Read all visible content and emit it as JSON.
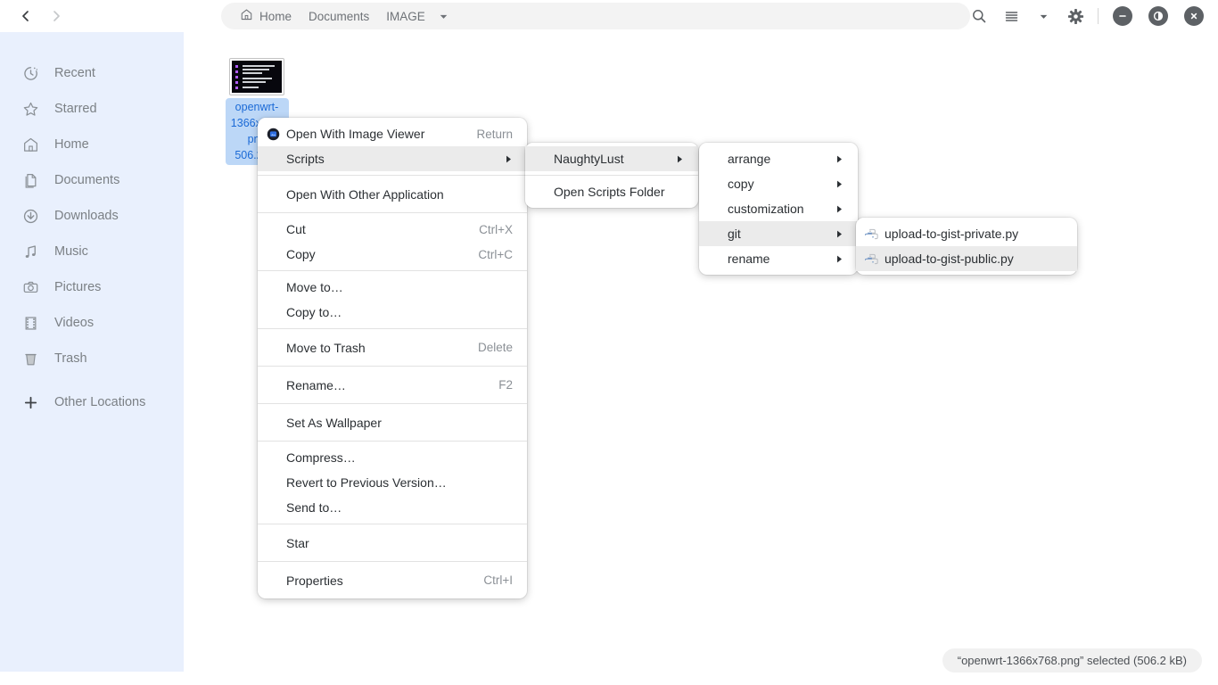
{
  "header": {
    "nav": {
      "back": "back-arrow",
      "forward": "forward-arrow"
    },
    "breadcrumbs": [
      {
        "label": "Home",
        "icon": "home-icon"
      },
      {
        "label": "Documents",
        "icon": ""
      },
      {
        "label": "IMAGE",
        "icon": ""
      }
    ],
    "actions": [
      {
        "name": "search-icon",
        "label": "Search"
      },
      {
        "name": "list-view-icon",
        "label": "View options"
      },
      {
        "name": "chevron-down-icon",
        "label": "View menu"
      },
      {
        "name": "gear-icon",
        "label": "Preferences"
      }
    ],
    "window_controls": [
      {
        "name": "minimize-button",
        "glyph": "minus"
      },
      {
        "name": "maximize-button",
        "glyph": "half-circle"
      },
      {
        "name": "close-button",
        "glyph": "cross"
      }
    ]
  },
  "sidebar": {
    "items": [
      {
        "label": "Recent",
        "icon": "clock-icon"
      },
      {
        "label": "Starred",
        "icon": "star-icon"
      },
      {
        "label": "Home",
        "icon": "home-icon"
      },
      {
        "label": "Documents",
        "icon": "documents-icon"
      },
      {
        "label": "Downloads",
        "icon": "download-icon"
      },
      {
        "label": "Music",
        "icon": "music-note-icon"
      },
      {
        "label": "Pictures",
        "icon": "camera-icon"
      },
      {
        "label": "Videos",
        "icon": "film-icon"
      },
      {
        "label": "Trash",
        "icon": "trash-icon"
      }
    ],
    "other_locations": {
      "label": "Other Locations",
      "icon": "plus-icon"
    }
  },
  "files": [
    {
      "name": "openwrt-1366x768.png",
      "size": "506.2 kB",
      "label_line1": "openwrt-",
      "label_line2": "1366x768.",
      "label_line3": "png",
      "label_line4": "506.2 kB",
      "selected": true
    }
  ],
  "status": {
    "text": "“openwrt-1366x768.png” selected (506.2 kB)"
  },
  "context_menu": {
    "items": [
      {
        "label": "Open With Image Viewer",
        "accel": "Return",
        "icon": "image-viewer-icon",
        "submenu": false,
        "highlighted": false
      },
      {
        "label": "Scripts",
        "accel": "",
        "icon": "",
        "submenu": true,
        "highlighted": true
      },
      {
        "sep": true
      },
      {
        "label": "Open With Other Application",
        "accel": "",
        "icon": "",
        "submenu": false,
        "highlighted": false
      },
      {
        "sep": true
      },
      {
        "label": "Cut",
        "accel": "Ctrl+X",
        "icon": "",
        "submenu": false,
        "highlighted": false
      },
      {
        "label": "Copy",
        "accel": "Ctrl+C",
        "icon": "",
        "submenu": false,
        "highlighted": false
      },
      {
        "sep": true
      },
      {
        "label": "Move to…",
        "accel": "",
        "icon": "",
        "submenu": false,
        "highlighted": false
      },
      {
        "label": "Copy to…",
        "accel": "",
        "icon": "",
        "submenu": false,
        "highlighted": false
      },
      {
        "sep": true
      },
      {
        "label": "Move to Trash",
        "accel": "Delete",
        "icon": "",
        "submenu": false,
        "highlighted": false
      },
      {
        "sep": true
      },
      {
        "label": "Rename…",
        "accel": "F2",
        "icon": "",
        "submenu": false,
        "highlighted": false
      },
      {
        "sep": true
      },
      {
        "label": "Set As Wallpaper",
        "accel": "",
        "icon": "",
        "submenu": false,
        "highlighted": false
      },
      {
        "sep": true
      },
      {
        "label": "Compress…",
        "accel": "",
        "icon": "",
        "submenu": false,
        "highlighted": false
      },
      {
        "label": "Revert to Previous Version…",
        "accel": "",
        "icon": "",
        "submenu": false,
        "highlighted": false
      },
      {
        "label": "Send to…",
        "accel": "",
        "icon": "",
        "submenu": false,
        "highlighted": false
      },
      {
        "sep": true
      },
      {
        "label": "Star",
        "accel": "",
        "icon": "",
        "submenu": false,
        "highlighted": false
      },
      {
        "sep": true
      },
      {
        "label": "Properties",
        "accel": "Ctrl+I",
        "icon": "",
        "submenu": false,
        "highlighted": false
      }
    ]
  },
  "scripts_menu": {
    "items": [
      {
        "label": "NaughtyLust",
        "submenu": true,
        "highlighted": true
      },
      {
        "sep": true
      },
      {
        "label": "Open Scripts Folder",
        "submenu": false,
        "highlighted": false
      }
    ]
  },
  "naughtylust_menu": {
    "items": [
      {
        "label": "arrange",
        "submenu": true,
        "highlighted": false
      },
      {
        "label": "copy",
        "submenu": true,
        "highlighted": false
      },
      {
        "label": "customization",
        "submenu": true,
        "highlighted": false
      },
      {
        "label": "git",
        "submenu": true,
        "highlighted": true
      },
      {
        "label": "rename",
        "submenu": true,
        "highlighted": false
      }
    ]
  },
  "git_menu": {
    "items": [
      {
        "label": "upload-to-gist-private.py",
        "icon": "python-script-icon",
        "highlighted": false
      },
      {
        "label": "upload-to-gist-public.py",
        "icon": "python-script-icon",
        "highlighted": true
      }
    ]
  },
  "colors": {
    "sidebar_bg": "#e9f0fd",
    "selection_blue": "#bcd7f7",
    "selection_text": "#1b6ad6",
    "menu_highlight": "#ebebeb",
    "pathbar_bg": "#f3f3f3",
    "window_btn": "#5d6165"
  }
}
